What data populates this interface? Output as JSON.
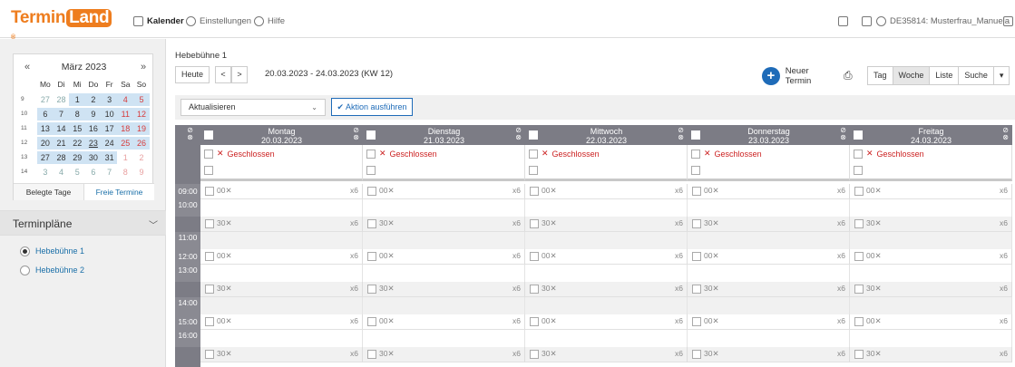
{
  "app": {
    "logo": "TerminLand",
    "logo_a": "Termin",
    "logo_b": "Land"
  },
  "nav": {
    "kalender": "Kalender",
    "einstellungen": "Einstellungen",
    "hilfe": "Hilfe",
    "user": "DE35814: Musterfrau_Manuela"
  },
  "calendar": {
    "month": "März 2023",
    "prev": "«",
    "next": "»",
    "dow": [
      "Mo",
      "Di",
      "Mi",
      "Do",
      "Fr",
      "Sa",
      "So"
    ],
    "weeks": [
      {
        "wk": "9",
        "days": [
          "27",
          "28",
          "1",
          "2",
          "3",
          "4",
          "5"
        ]
      },
      {
        "wk": "10",
        "days": [
          "6",
          "7",
          "8",
          "9",
          "10",
          "11",
          "12"
        ]
      },
      {
        "wk": "11",
        "days": [
          "13",
          "14",
          "15",
          "16",
          "17",
          "18",
          "19"
        ]
      },
      {
        "wk": "12",
        "days": [
          "20",
          "21",
          "22",
          "23",
          "24",
          "25",
          "26"
        ]
      },
      {
        "wk": "13",
        "days": [
          "27",
          "28",
          "29",
          "30",
          "31",
          "1",
          "2"
        ]
      },
      {
        "wk": "14",
        "days": [
          "3",
          "4",
          "5",
          "6",
          "7",
          "8",
          "9"
        ]
      }
    ],
    "tab_booked": "Belegte Tage",
    "tab_free": "Freie Termine"
  },
  "plans": {
    "title": "Terminpläne",
    "items": [
      "Hebebühne 1",
      "Hebebühne 2"
    ]
  },
  "main": {
    "resource": "Hebebühne 1",
    "today": "Heute",
    "range": "20.03.2023 - 24.03.2023 (KW 12)",
    "new_appt": "Neuer Termin",
    "views": [
      "Tag",
      "Woche",
      "Liste",
      "Suche"
    ],
    "active_view": "Woche",
    "select_value": "Aktualisieren",
    "action": "Aktion ausführen"
  },
  "week": {
    "days": [
      {
        "name": "Montag",
        "date": "20.03.2023"
      },
      {
        "name": "Dienstag",
        "date": "21.03.2023"
      },
      {
        "name": "Mittwoch",
        "date": "22.03.2023"
      },
      {
        "name": "Donnerstag",
        "date": "23.03.2023"
      },
      {
        "name": "Freitag",
        "date": "24.03.2023"
      }
    ],
    "closed_label": "Geschlossen",
    "times": [
      "09:00",
      "10:00",
      "11:00",
      "12:00",
      "13:00",
      "14:00",
      "15:00",
      "16:00"
    ],
    "slot_00": "00",
    "slot_30": "30",
    "capacity": "x6"
  }
}
